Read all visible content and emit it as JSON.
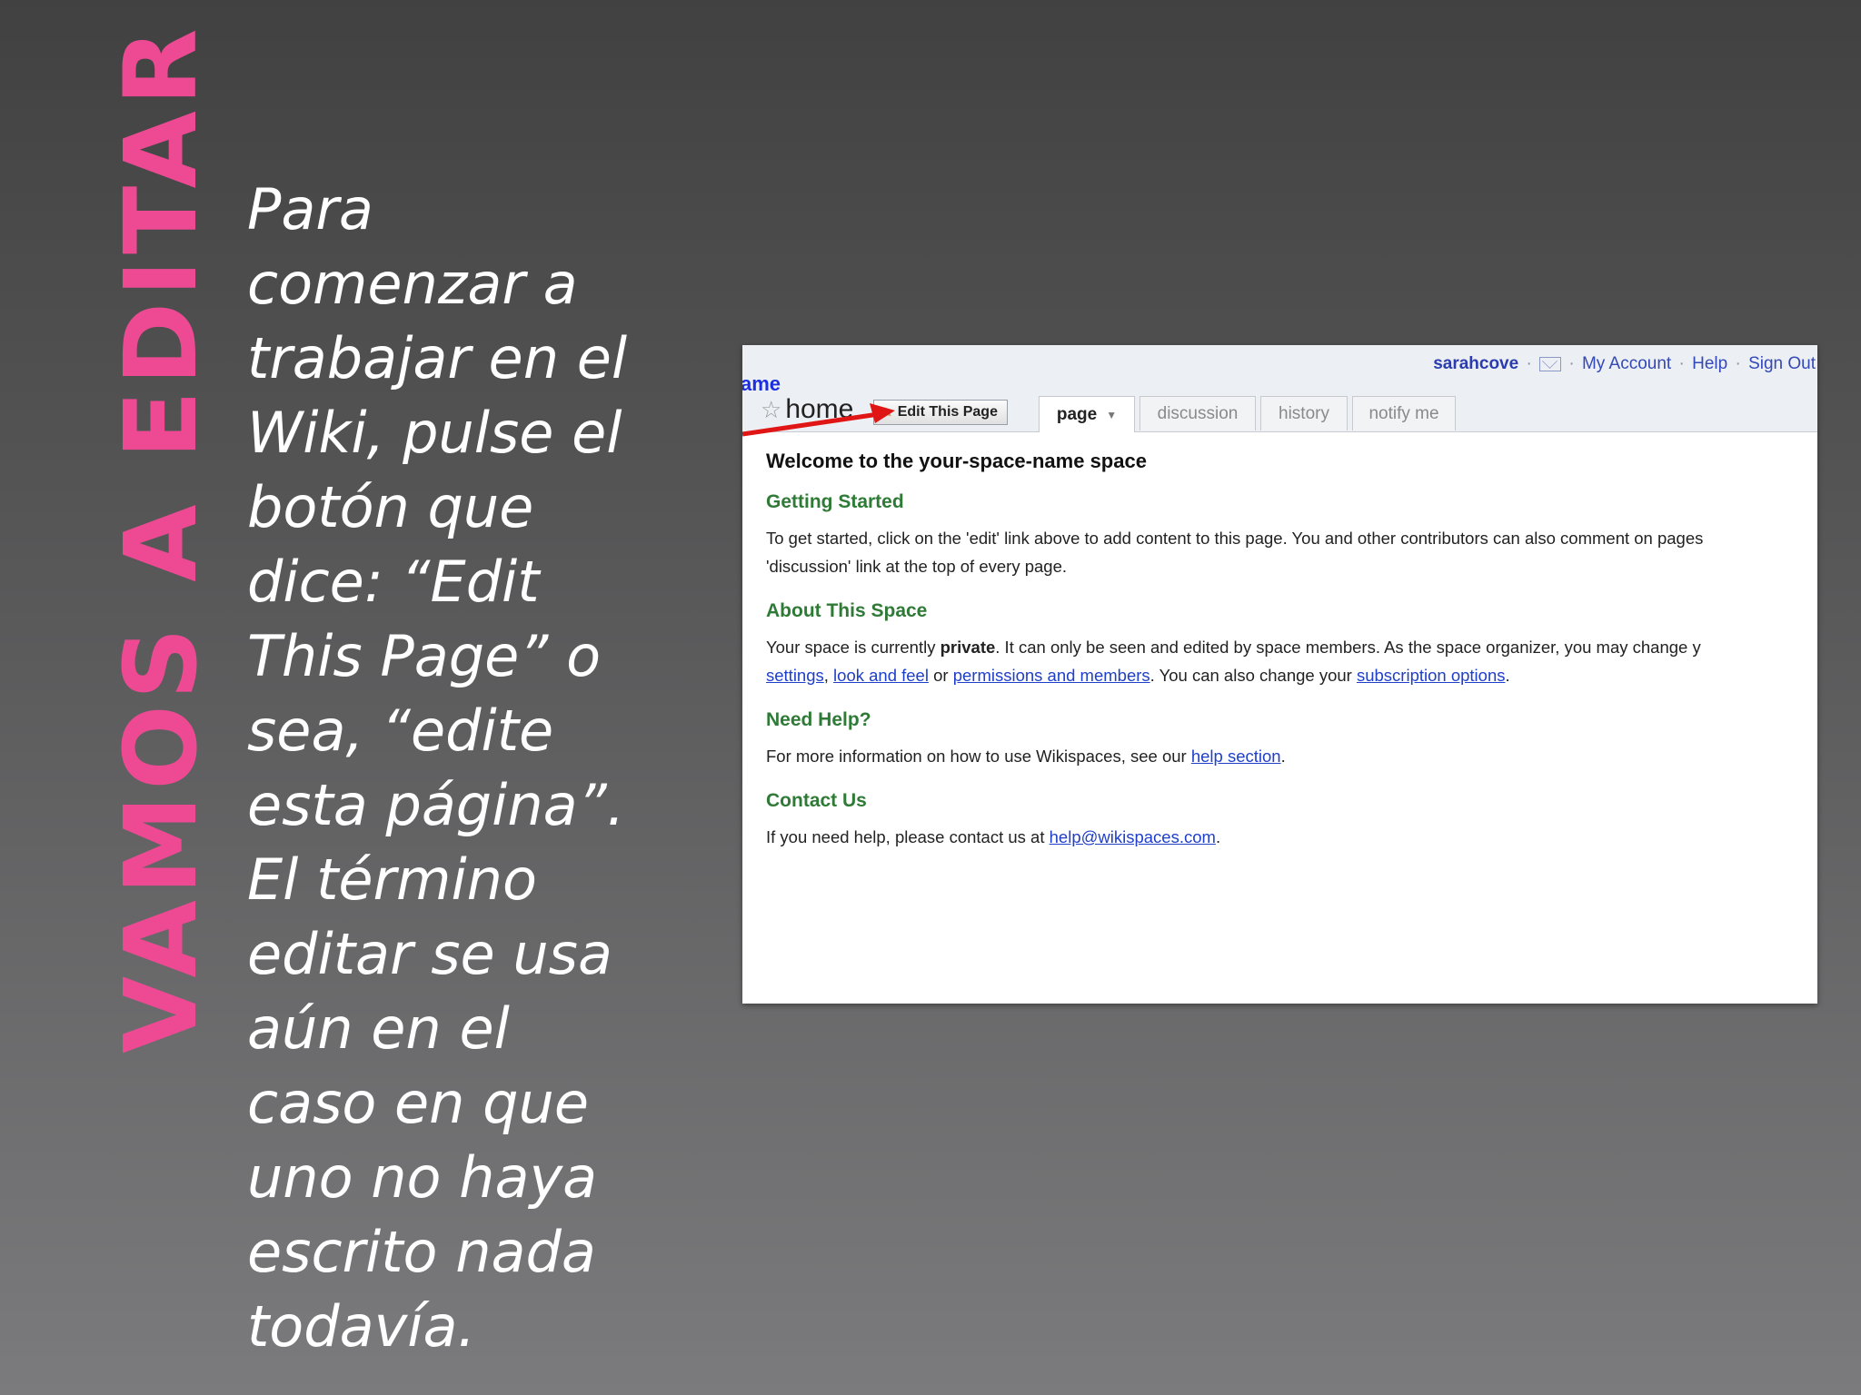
{
  "slide": {
    "title": "VAMOS A EDITAR",
    "body_lines": [
      "Para",
      "comenzar a",
      "trabajar en el",
      "Wiki, pulse el",
      "botón que",
      "dice: “Edit",
      "This Page” o",
      "sea, “edite",
      "esta página”.",
      "El término",
      "editar se usa",
      "aún en el",
      "caso en que",
      "uno no haya",
      "escrito nada",
      "todavía."
    ]
  },
  "wiki": {
    "userbar": {
      "user": "sarahcove",
      "sep": "·",
      "my_account": "My Account",
      "help": "Help",
      "sign_out": "Sign Out"
    },
    "space_name": "ame",
    "page_name": "home",
    "edit_button": "Edit This Page",
    "tabs": [
      "page",
      "discussion",
      "history",
      "notify me"
    ],
    "welcome": "Welcome to the your-space-name space",
    "sections": {
      "getting_started": {
        "heading": "Getting Started",
        "line1": "To get started, click on the 'edit' link above to add content to this page. You and other contributors can also comment on pages",
        "line2": "'discussion' link at the top of every page."
      },
      "about": {
        "heading": "About This Space",
        "line1_a": "Your space is currently ",
        "line1_b": "private",
        "line1_c": ". It can only be seen and edited by space members. As the space organizer, you may change y",
        "link_settings": "settings",
        "comma": ", ",
        "link_look": "look and feel",
        "or": " or ",
        "link_permissions": "permissions and members",
        "line2_mid": ". You can also change your ",
        "link_subscription": "subscription options",
        "period": "."
      },
      "help": {
        "heading": "Need Help?",
        "text": "For more information on how to use Wikispaces, see our ",
        "link": "help section",
        "period": "."
      },
      "contact": {
        "heading": "Contact Us",
        "text": "If you need help, please contact us at ",
        "link": "help@wikispaces.com",
        "period": "."
      }
    }
  }
}
